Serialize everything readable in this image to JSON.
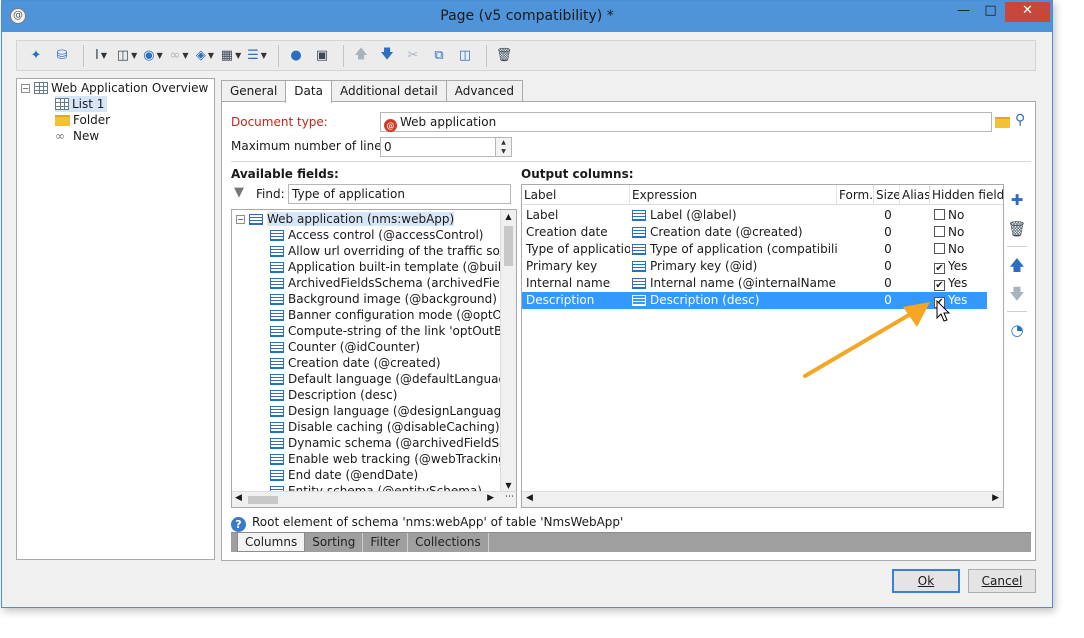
{
  "window": {
    "title": "Page (v5 compatibility) *"
  },
  "toolbar": {
    "icons": [
      "wand-icon",
      "database-icon",
      "text-cursor-icon",
      "filter-icon",
      "globe-icon",
      "link-icon",
      "cube-icon",
      "table-icon",
      "columns-icon",
      "user-icon",
      "add-object-icon",
      "arrow-up-icon",
      "arrow-down-icon",
      "cut-icon",
      "copy-icon",
      "paste-icon",
      "delete-icon"
    ]
  },
  "tree": {
    "root": "Web Application Overview",
    "items": [
      "List 1",
      "Folder",
      "New"
    ]
  },
  "tabs": [
    "General",
    "Data",
    "Additional detail",
    "Advanced"
  ],
  "form": {
    "document_type_label": "Document type:",
    "document_type_value": "Web application",
    "max_lines_label": "Maximum number of lines:",
    "max_lines_value": "0"
  },
  "available_fields": {
    "title": "Available fields:",
    "find_label": "Find:",
    "find_value": "Type of application",
    "root": "Web application (nms:webApp)",
    "items": [
      "Access control (@accessControl)",
      "Allow url overriding of the traffic source",
      "Application built-in template (@builtIn)",
      "ArchivedFieldsSchema (archivedFieldsSc",
      "Background image (@background)",
      "Banner configuration mode (@optOutBa",
      "Compute-string of the link 'optOutBann",
      "Counter (@idCounter)",
      "Creation date (@created)",
      "Default language (@defaultLanguage)",
      "Description (desc)",
      "Design language (@designLanguage)",
      "Disable caching (@disableCaching)",
      "Dynamic schema (@archivedFieldSchem",
      "Enable web tracking (@webTrackingEna",
      "End date (@endDate)",
      "Entity schema (@entitySchema)"
    ]
  },
  "output_columns": {
    "title": "Output columns:",
    "headers": [
      "Label",
      "Expression",
      "Form...",
      "Size",
      "Alias",
      "Hidden field"
    ],
    "rows": [
      {
        "label": "Label",
        "expression": "Label (@label)",
        "size": "0",
        "hidden": "No",
        "checked": false
      },
      {
        "label": "Creation date",
        "expression": "Creation date (@created)",
        "size": "0",
        "hidden": "No",
        "checked": false
      },
      {
        "label": "Type of application...",
        "expression": "Type of application (compatibility) .",
        "size": "0",
        "hidden": "No",
        "checked": false
      },
      {
        "label": "Primary key",
        "expression": "Primary key (@id)",
        "size": "0",
        "hidden": "Yes",
        "checked": true
      },
      {
        "label": "Internal name",
        "expression": "Internal name (@internalName)",
        "size": "0",
        "hidden": "Yes",
        "checked": true
      },
      {
        "label": "Description",
        "expression": "Description (desc)",
        "size": "0",
        "hidden": "Yes",
        "checked": true
      }
    ],
    "selected_row": 5
  },
  "hint": "Root element of schema 'nms:webApp' of table 'NmsWebApp'",
  "bottom_tabs": [
    "Columns",
    "Sorting",
    "Filter",
    "Collections"
  ],
  "buttons": {
    "ok": "Ok",
    "cancel": "Cancel"
  },
  "colors": {
    "selection": "#3399ff",
    "required_label": "#c0261a",
    "annotation_arrow": "#f5a623"
  }
}
